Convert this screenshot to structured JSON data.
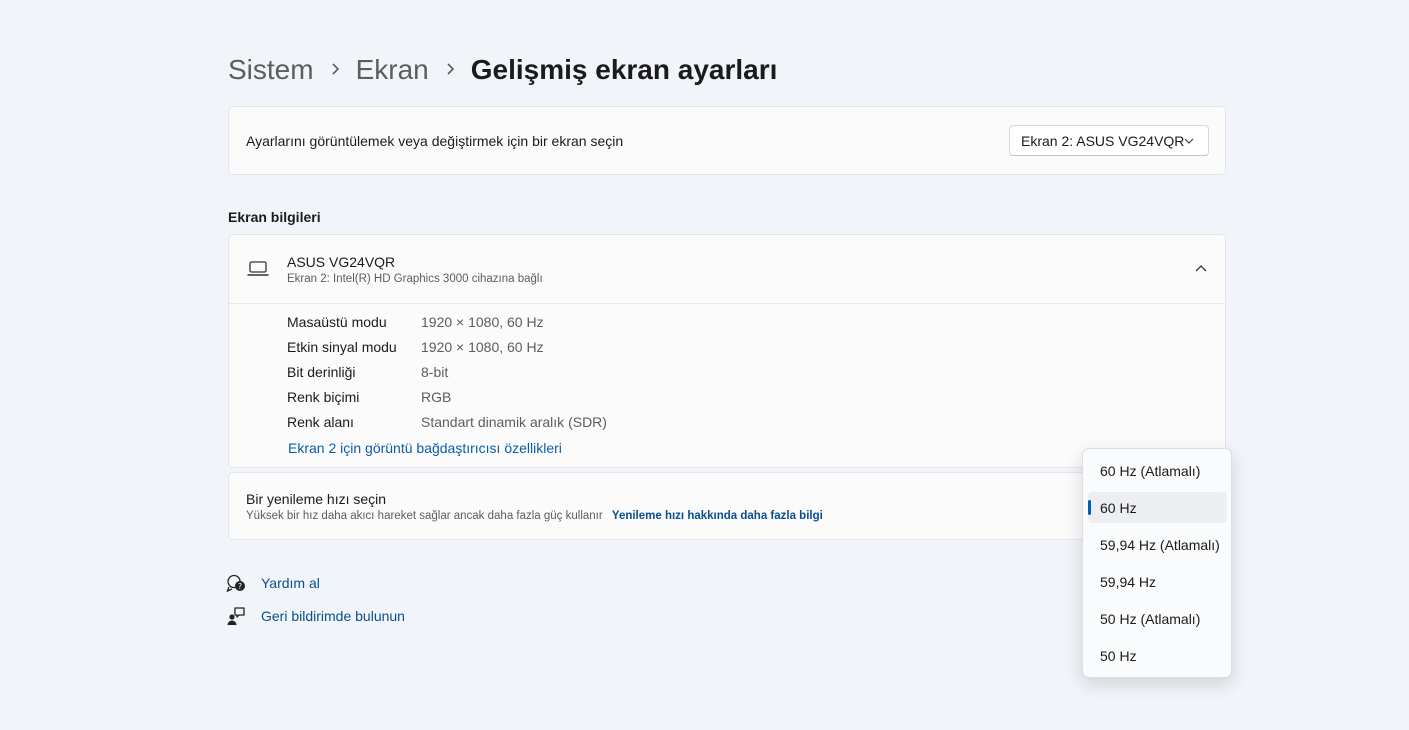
{
  "breadcrumb": {
    "items": [
      "Sistem",
      "Ekran"
    ],
    "current": "Gelişmiş ekran ayarları"
  },
  "display_select": {
    "label": "Ayarlarını görüntülemek veya değiştirmek için bir ekran seçin",
    "selected": "Ekran 2: ASUS VG24VQR"
  },
  "display_info": {
    "section_title": "Ekran bilgileri",
    "monitor_name": "ASUS VG24VQR",
    "monitor_sub": "Ekran 2: Intel(R) HD Graphics 3000 cihazına bağlı",
    "properties": [
      {
        "name": "Masaüstü modu",
        "value": "1920 × 1080, 60 Hz"
      },
      {
        "name": "Etkin sinyal modu",
        "value": "1920 × 1080, 60 Hz"
      },
      {
        "name": "Bit derinliği",
        "value": "8-bit"
      },
      {
        "name": "Renk biçimi",
        "value": "RGB"
      },
      {
        "name": "Renk alanı",
        "value": "Standart dinamik aralık (SDR)"
      }
    ],
    "adapter_link": "Ekran 2 için görüntü bağdaştırıcısı özellikleri"
  },
  "refresh": {
    "title": "Bir yenileme hızı seçin",
    "description": "Yüksek bir hız daha akıcı hareket sağlar ancak daha fazla güç kullanır",
    "link": "Yenileme hızı hakkında daha fazla bilgi",
    "options": [
      "60 Hz (Atlamalı)",
      "60 Hz",
      "59,94 Hz (Atlamalı)",
      "59,94 Hz",
      "50 Hz (Atlamalı)",
      "50 Hz"
    ],
    "selected_index": 1
  },
  "help": {
    "get_help": "Yardım al",
    "feedback": "Geri bildirimde bulunun"
  },
  "colors": {
    "background": "#f1f4f9",
    "card": "#fbfbfc",
    "link": "#0a4f8e",
    "accent": "#005fb8"
  },
  "icons": {
    "breadcrumb_separator": "chevron-right-icon",
    "dropdown": "chevron-down-icon",
    "monitor": "laptop-icon",
    "collapse": "chevron-up-icon",
    "help": "help-chat-icon",
    "feedback": "feedback-icon"
  }
}
